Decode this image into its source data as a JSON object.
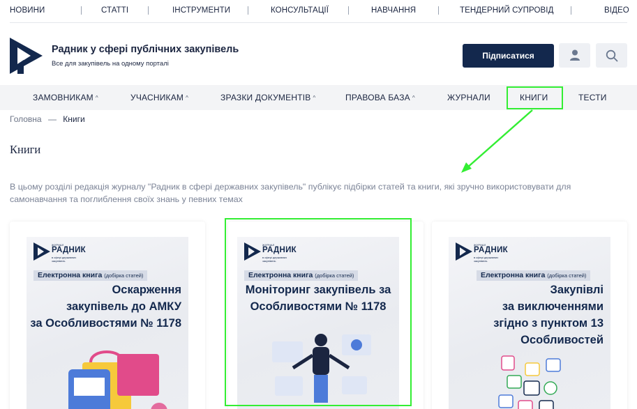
{
  "top_nav": [
    {
      "label": "НОВИНИ"
    },
    {
      "label": "СТАТТІ"
    },
    {
      "label": "ІНСТРУМЕНТИ"
    },
    {
      "label": "КОНСУЛЬТАЦІЇ"
    },
    {
      "label": "НАВЧАННЯ"
    },
    {
      "label": "ТЕНДЕРНИЙ СУПРОВІД"
    },
    {
      "label": "ВІДЕО"
    }
  ],
  "header": {
    "title": "Радник у сфері публічних закупівель",
    "subtitle": "Все для закупівель на одному порталі",
    "subscribe_label": "Підписатися",
    "user_icon": "user-icon",
    "search_icon": "search-icon"
  },
  "main_nav": [
    {
      "label": "ЗАМОВНИКАМ",
      "has_caret": true
    },
    {
      "label": "УЧАСНИКАМ",
      "has_caret": true
    },
    {
      "label": "ЗРАЗКИ ДОКУМЕНТІВ",
      "has_caret": true
    },
    {
      "label": "ПРАВОВА БАЗА",
      "has_caret": true
    },
    {
      "label": "ЖУРНАЛИ",
      "has_caret": false
    },
    {
      "label": "КНИГИ",
      "has_caret": false
    },
    {
      "label": "ТЕСТИ",
      "has_caret": false
    }
  ],
  "breadcrumb": {
    "home": "Головна",
    "separator": "—",
    "current": "Книги"
  },
  "page": {
    "title": "Книги",
    "intro": "В цьому розділі редакція журналу \"Радник в сфері державних закупівель\" публікує підбірки статей та книги, які зручно використовувати для самонавчання та поглиблення своїх знань у певних темах"
  },
  "books": [
    {
      "brand_small": "ЖУРНАЛ",
      "brand_name": "РАДНИК",
      "brand_tag": "в сфері державних закупівель",
      "ebook_label": "Електронна книга",
      "ebook_note": "(добірка статей)",
      "title": "Оскарження\nзакупівель до АМКУ\nза Особливостями № 1178"
    },
    {
      "brand_small": "ЖУРНАЛ",
      "brand_name": "РАДНИК",
      "brand_tag": "в сфері державних закупівель",
      "ebook_label": "Електронна книга",
      "ebook_note": "(добірка статей)",
      "title": "Моніторинг закупівель за\nОсобливостями № 1178"
    },
    {
      "brand_small": "ЖУРНАЛ",
      "brand_name": "РАДНИК",
      "brand_tag": "в сфері державних закупівель",
      "ebook_label": "Електронна книга",
      "ebook_note": "(добірка статей)",
      "title": "Закупівлі\nза виключеннями\nзгідно з пунктом 13\nОсобливостей"
    }
  ],
  "colors": {
    "brand_navy": "#13284d",
    "highlight_green": "#33ee33",
    "nav_bg": "#f3f4f6"
  }
}
